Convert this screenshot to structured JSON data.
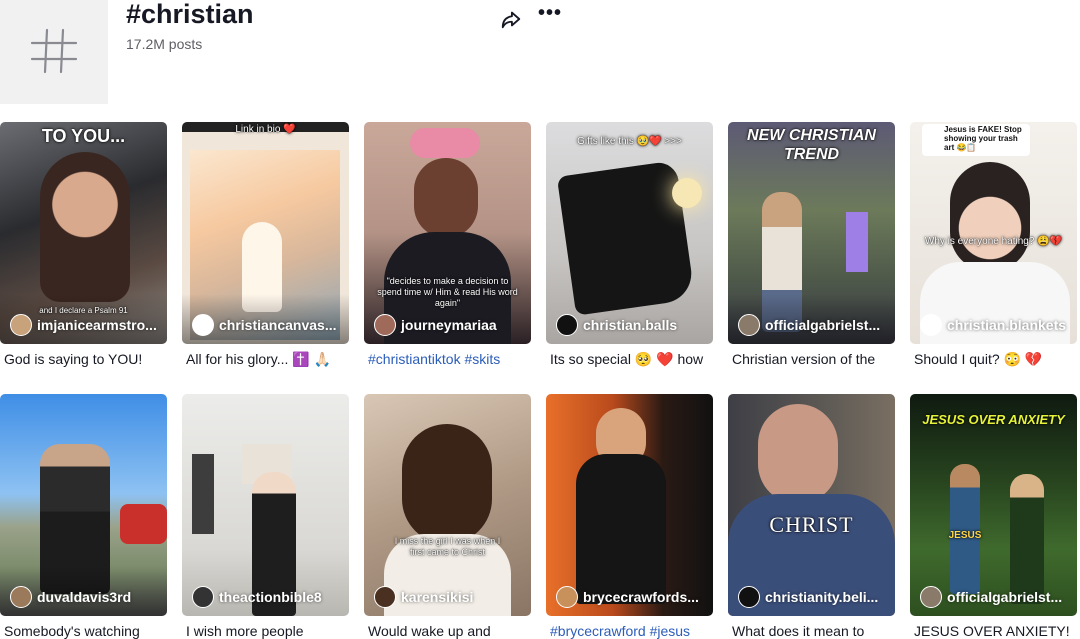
{
  "header": {
    "title": "#christian",
    "post_count": "17.2M posts",
    "icons": [
      "hashtag-icon",
      "share-icon",
      "more-icon"
    ]
  },
  "videos": [
    {
      "overlay": "TO YOU...",
      "sub_overlay": "and I declare a Psalm 91",
      "author": "imjanicearmstro...",
      "caption": "God is saying to YOU!",
      "caption_is_link": false
    },
    {
      "overlay": "Link in bio ❤️",
      "sub_overlay": "",
      "author": "christiancanvas...",
      "caption": "All for his glory... ✝️ 🙏🏻",
      "caption_is_link": false
    },
    {
      "overlay": "",
      "sub_overlay": "\"decides to make a decision to spend time w/ Him & read His word again\"",
      "author": "journeymariaa",
      "caption": "#christiantiktok #skits",
      "caption_is_link": true
    },
    {
      "overlay": "Gifts like this 🥹❤️ >>>",
      "sub_overlay": "",
      "author": "christian.balls",
      "caption": "Its so special 🥺 ❤️ how",
      "caption_is_link": false
    },
    {
      "overlay": "NEW CHRISTIAN TREND",
      "sub_overlay": "",
      "author": "officialgabrielst...",
      "caption": "Christian version of the",
      "caption_is_link": false
    },
    {
      "overlay": "Jesus is FAKE! Stop showing your trash art 😂📋",
      "sub_overlay": "Why is everyone hating? 😩💔",
      "author": "christian.blankets",
      "caption": "Should I quit? 😳 💔",
      "caption_is_link": false
    },
    {
      "overlay": "",
      "sub_overlay": "",
      "author": "duvaldavis3rd",
      "caption": "Somebody's watching",
      "caption_is_link": false
    },
    {
      "overlay": "",
      "sub_overlay": "",
      "author": "theactionbible8",
      "caption": "I wish more people",
      "caption_is_link": false
    },
    {
      "overlay": "",
      "sub_overlay": "I miss the girl I was when I first came to Christ",
      "author": "karensikisi",
      "caption": "Would wake up and",
      "caption_is_link": false
    },
    {
      "overlay": "",
      "sub_overlay": "",
      "author": "brycecrawfords...",
      "caption": "#brycecrawford #jesus",
      "caption_is_link": true
    },
    {
      "overlay": "CHRIST",
      "sub_overlay": "",
      "author": "christianity.beli...",
      "caption": "What does it mean to",
      "caption_is_link": false
    },
    {
      "overlay": "JESUS OVER ANXIETY",
      "sub_overlay": "JESUS",
      "author": "officialgabrielst...",
      "caption": "JESUS OVER ANXIETY!",
      "caption_is_link": false
    }
  ]
}
